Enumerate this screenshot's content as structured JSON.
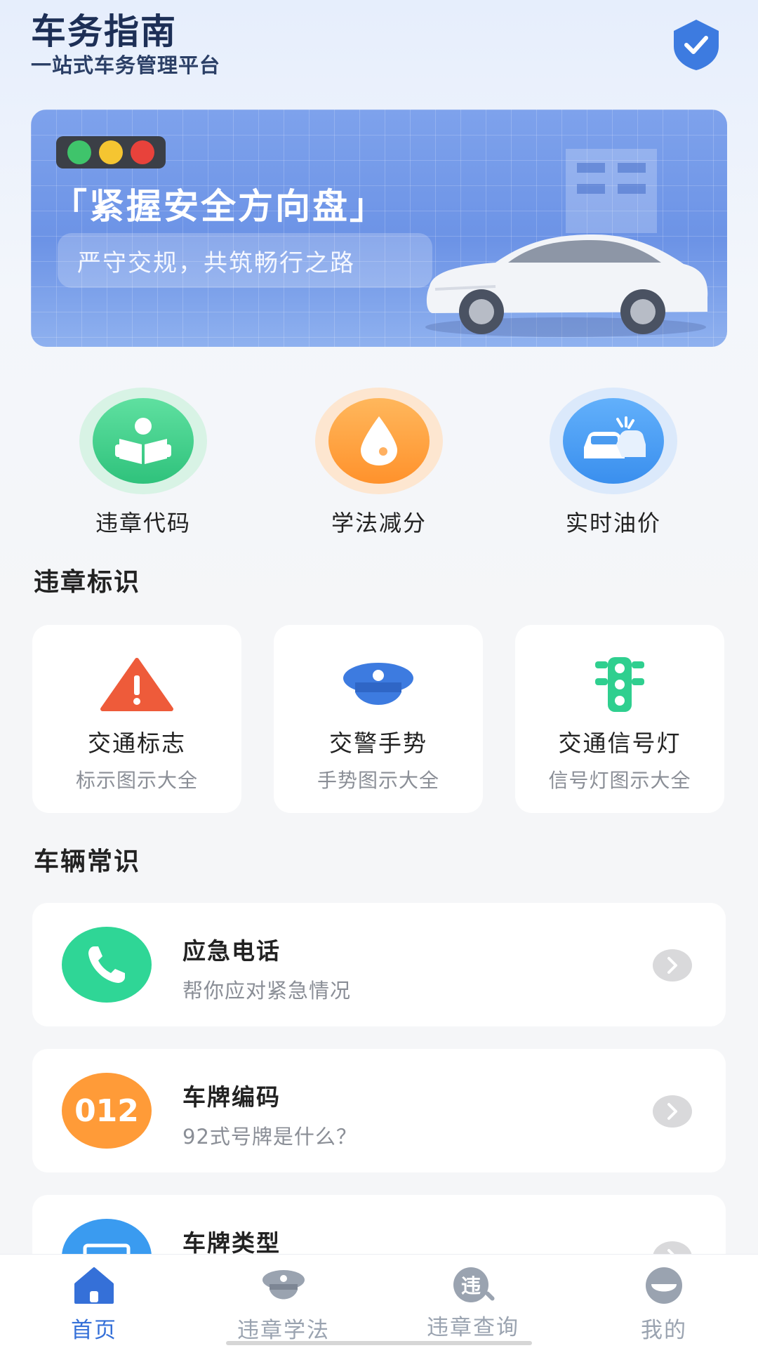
{
  "header": {
    "title": "车务指南",
    "subtitle": "一站式车务管理平台",
    "shield_icon": "shield-check-icon"
  },
  "banner": {
    "headline": "「紧握安全方向盘」",
    "slogan": "严守交规，共筑畅行之路",
    "colors": {
      "red": "#e8423b",
      "yellow": "#f5c531",
      "green": "#3fc46b"
    }
  },
  "quick_tools": [
    {
      "label": "违章代码",
      "icon": "reading-person-icon",
      "color": "#3fd08a"
    },
    {
      "label": "学法减分",
      "icon": "water-drop-icon",
      "color": "#ff9f3a"
    },
    {
      "label": "实时油价",
      "icon": "car-collision-icon",
      "color": "#4a9bf0"
    }
  ],
  "sections": {
    "signs_title": "违章标识",
    "vehicle_title": "车辆常识"
  },
  "sign_cards": [
    {
      "title": "交通标志",
      "subtitle": "标示图示大全",
      "icon": "warning-triangle-icon"
    },
    {
      "title": "交警手势",
      "subtitle": "手势图示大全",
      "icon": "police-cap-icon"
    },
    {
      "title": "交通信号灯",
      "subtitle": "信号灯图示大全",
      "icon": "traffic-light-icon"
    }
  ],
  "vehicle_list": [
    {
      "title": "应急电话",
      "subtitle": "帮你应对紧急情况",
      "icon": "phone-icon",
      "color": "#2fd696"
    },
    {
      "title": "车牌编码",
      "subtitle": "92式号牌是什么？",
      "icon_text": "012",
      "icon": "number-plate-code-icon",
      "color": "#ff9b38"
    },
    {
      "title": "车牌类型",
      "subtitle": "",
      "icon": "license-plate-icon",
      "color": "#3a9bf0"
    }
  ],
  "bottom_nav": [
    {
      "label": "首页",
      "icon": "home-icon",
      "active": true
    },
    {
      "label": "违章学法",
      "icon": "police-cap-icon",
      "active": false
    },
    {
      "label": "违章查询",
      "icon": "violation-search-icon",
      "icon_text": "违",
      "active": false
    },
    {
      "label": "我的",
      "icon": "profile-icon",
      "active": false
    }
  ],
  "nav_colors": {
    "active": "#3570d8",
    "inactive": "#9aa3b0"
  }
}
